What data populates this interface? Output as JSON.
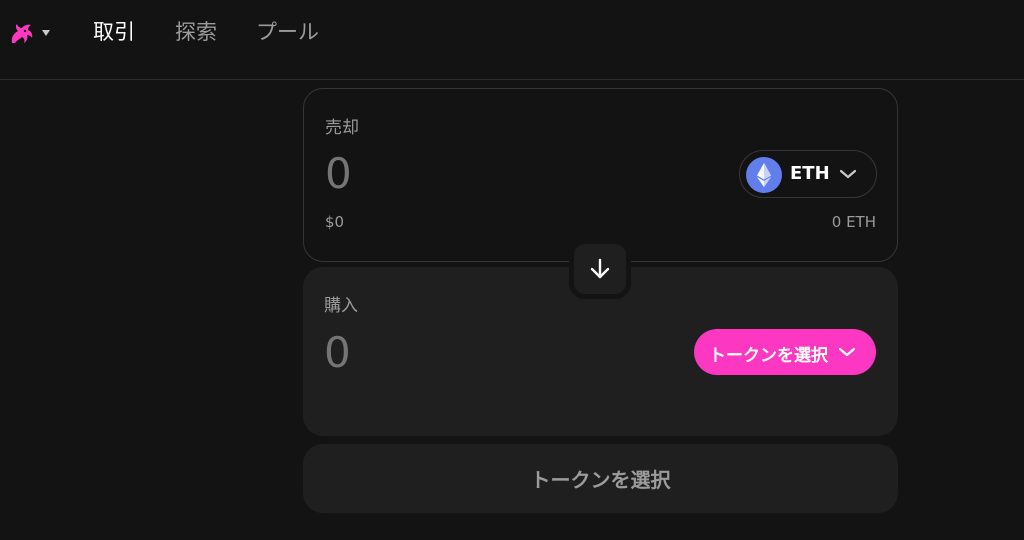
{
  "nav": {
    "tabs": [
      {
        "label": "取引",
        "active": true
      },
      {
        "label": "探索",
        "active": false
      },
      {
        "label": "プール",
        "active": false
      }
    ],
    "logo_icon": "unicorn-logo-icon",
    "logo_color": "#fc37c2"
  },
  "sell": {
    "label": "売却",
    "amount": "0",
    "usd_value": "$0",
    "balance": "0 ETH",
    "token": {
      "symbol": "ETH",
      "icon": "eth-icon",
      "color": "#627eea"
    }
  },
  "swap_direction_icon": "arrow-down-icon",
  "buy": {
    "label": "購入",
    "amount": "0",
    "select_token_label": "トークンを選択",
    "accent_color": "#fc37c2"
  },
  "action_button": {
    "label": "トークンを選択"
  }
}
